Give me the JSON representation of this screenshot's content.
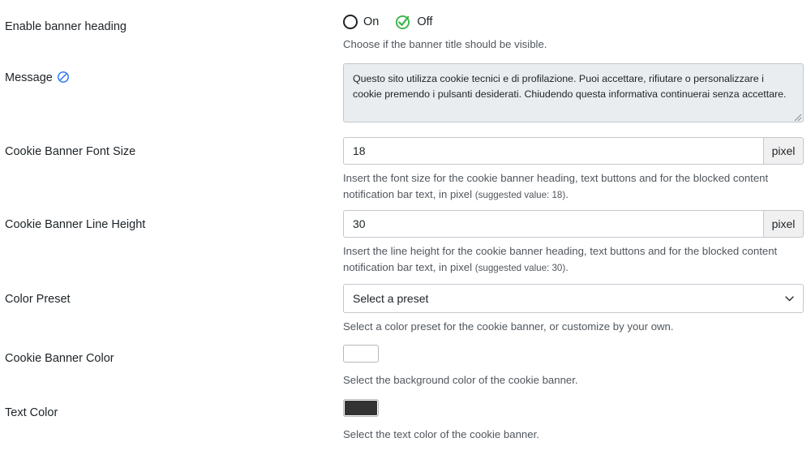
{
  "fields": [
    {
      "label": "Enable banner heading",
      "type": "radio",
      "options": [
        {
          "label": "On",
          "selected": false
        },
        {
          "label": "Off",
          "selected": true
        }
      ],
      "hint": "Choose if the banner title should be visible."
    },
    {
      "label": "Message",
      "icon": "translate-disabled-icon",
      "type": "textarea",
      "value": "Questo sito utilizza cookie tecnici e di profilazione. Puoi accettare, rifiutare o personalizzare i cookie premendo i pulsanti desiderati. Chiudendo questa informativa continuerai senza accettare."
    },
    {
      "label": "Cookie Banner Font Size",
      "type": "input-addon",
      "value": "18",
      "addon": "pixel",
      "hint_main": "Insert the font size for the cookie banner heading, text buttons and for the blocked content notification bar text, in pixel ",
      "hint_small": "(suggested value: 18)",
      "hint_tail": "."
    },
    {
      "label": "Cookie Banner Line Height",
      "type": "input-addon",
      "value": "30",
      "addon": "pixel",
      "hint_main": "Insert the line height for the cookie banner heading, text buttons and for the blocked content notification bar text, in pixel ",
      "hint_small": "(suggested value: 30)",
      "hint_tail": "."
    },
    {
      "label": "Color Preset",
      "type": "select",
      "value": "Select a preset",
      "hint": "Select a color preset for the cookie banner, or customize by your own."
    },
    {
      "label": "Cookie Banner Color",
      "type": "color",
      "color": "#ffffff",
      "hint": "Select the background color of the cookie banner."
    },
    {
      "label": "Text Color",
      "type": "color",
      "color": "#333333",
      "hint": "Select the text color of the cookie banner."
    }
  ],
  "colors": {
    "accent_green": "#3ab54a",
    "icon_blue": "#2271f0",
    "text": "#1d2327",
    "hint": "#50575e",
    "border": "#c3c8cd",
    "addon_bg": "#f0f0f1",
    "textarea_bg": "#e9edf0"
  }
}
